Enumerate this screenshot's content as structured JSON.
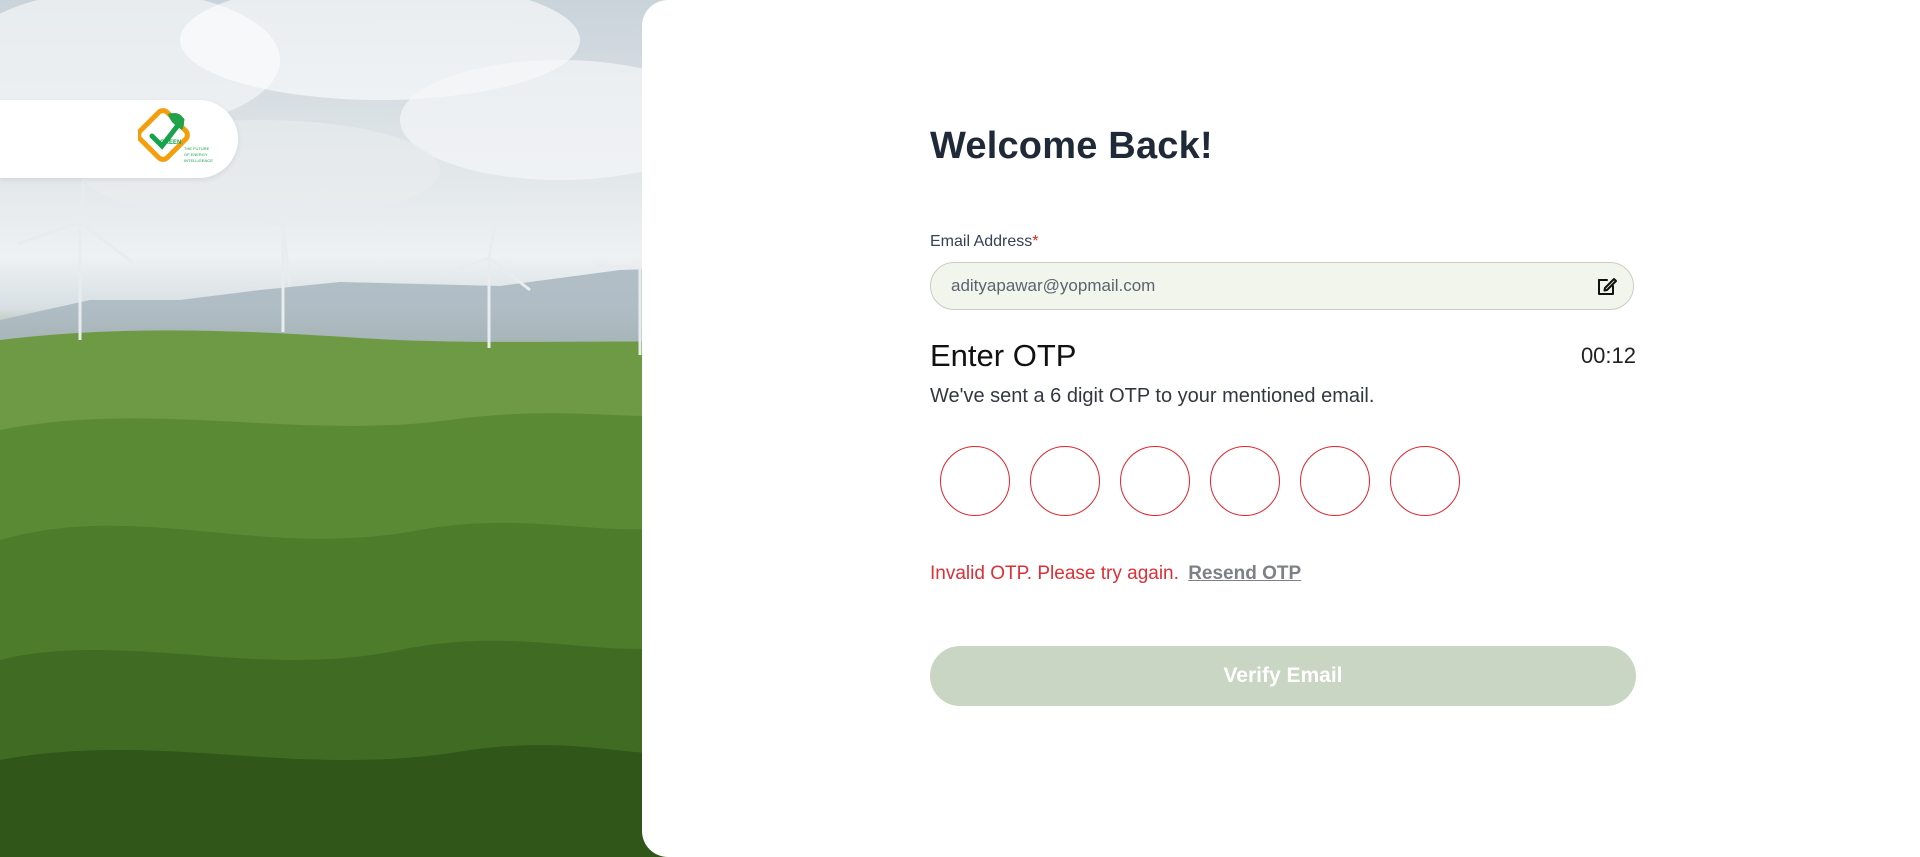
{
  "brand": {
    "logo_icon": "leaf-check-icon",
    "tagline": "THE FUTURE OF ENERGY INTELLIGENCE"
  },
  "form": {
    "title": "Welcome Back!",
    "email_label": "Email Address",
    "required_mark": "*",
    "email_value": "adityapawar@yopmail.com",
    "edit_icon": "edit-icon",
    "otp_heading": "Enter OTP",
    "timer": "00:12",
    "otp_subtitle": "We've sent a 6 digit OTP to your mentioned email.",
    "otp_digits": [
      "",
      "",
      "",
      "",
      "",
      ""
    ],
    "error_text": "Invalid OTP. Please try again.",
    "resend_label": "Resend OTP",
    "verify_label": "Verify Email"
  },
  "colors": {
    "accent_green": "#c9d6c3",
    "error_red": "#dc2f36",
    "field_bg": "#f1f5ec"
  }
}
